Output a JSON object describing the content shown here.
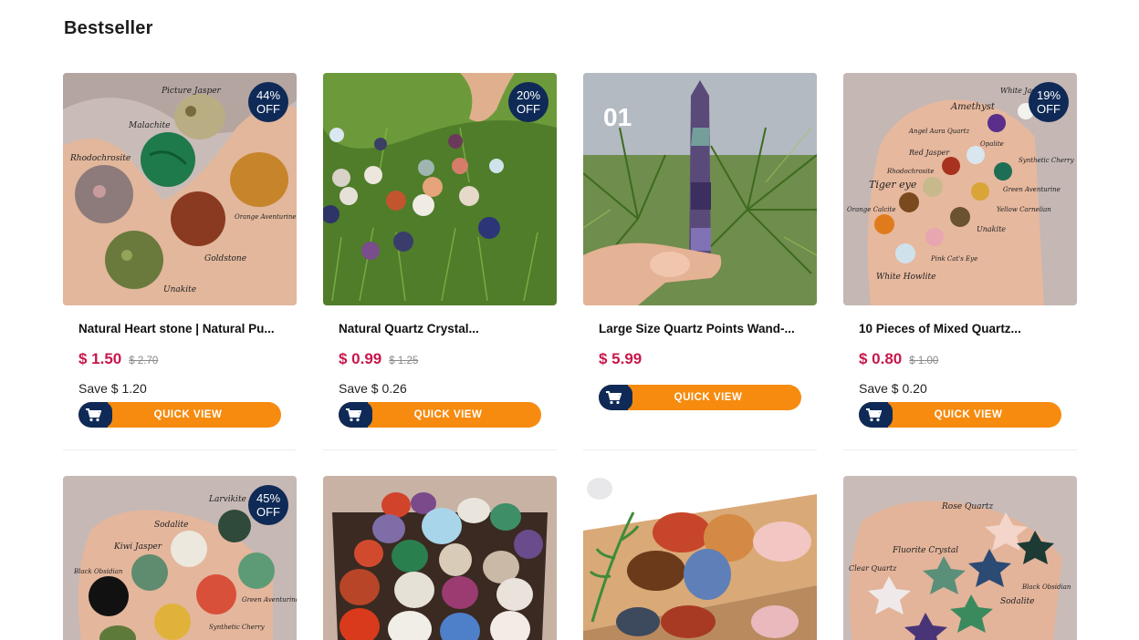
{
  "section": {
    "title": "Bestseller"
  },
  "products": [
    {
      "title": "Natural Heart stone | Natural Pu...",
      "price": "$ 1.50",
      "old_price": "$ 2.70",
      "save": "Save $ 1.20",
      "badge_pct": "44%",
      "badge_off": "OFF",
      "button": "QUICK VIEW"
    },
    {
      "title": "Natural Quartz Crystal...",
      "price": "$ 0.99",
      "old_price": "$ 1.25",
      "save": "Save $ 0.26",
      "badge_pct": "20%",
      "badge_off": "OFF",
      "button": "QUICK VIEW"
    },
    {
      "title": "Large Size Quartz Points Wand-...",
      "price": "$ 5.99",
      "old_price": "",
      "save": "",
      "badge_pct": "",
      "badge_off": "",
      "button": "QUICK VIEW",
      "image_caption": "01"
    },
    {
      "title": "10 Pieces of Mixed Quartz...",
      "price": "$ 0.80",
      "old_price": "$ 1.00",
      "save": "Save $ 0.20",
      "badge_pct": "19%",
      "badge_off": "OFF",
      "button": "QUICK VIEW"
    },
    {
      "badge_pct": "45%",
      "badge_off": "OFF"
    },
    {
      "badge_pct": "",
      "badge_off": ""
    },
    {
      "badge_pct": "",
      "badge_off": ""
    },
    {
      "badge_pct": "",
      "badge_off": ""
    }
  ],
  "image_labels": {
    "p1": [
      "Picture Jasper",
      "Malachite",
      "Rhodochrosite",
      "Orange Aventurine",
      "Goldstone",
      "Unakite"
    ],
    "p4": [
      "Amethyst",
      "White Jade",
      "Angel Aura Quartz",
      "Red Jasper",
      "Rhodochrosite",
      "Tiger eye",
      "Opalite",
      "Synthetic Cherry",
      "Green Aventurine",
      "Orange Calcite",
      "Yellow Carnelian",
      "Unakite",
      "Pink Cat's Eye",
      "White Howlite"
    ],
    "p5": [
      "Larvikite",
      "Sodalite",
      "Kiwi Jasper",
      "Black Obsidian",
      "Green Aventurine",
      "Synthetic Cherry"
    ],
    "p8": [
      "Rose Quartz",
      "Fluorite Crystal",
      "Clear Quartz",
      "Black Obsidian",
      "Sodalite"
    ]
  },
  "colors": {
    "accent": "#f68b0f",
    "navy": "#0f2a56",
    "price": "#c8174b"
  },
  "icons": {
    "cart": "shopping-cart-icon"
  }
}
